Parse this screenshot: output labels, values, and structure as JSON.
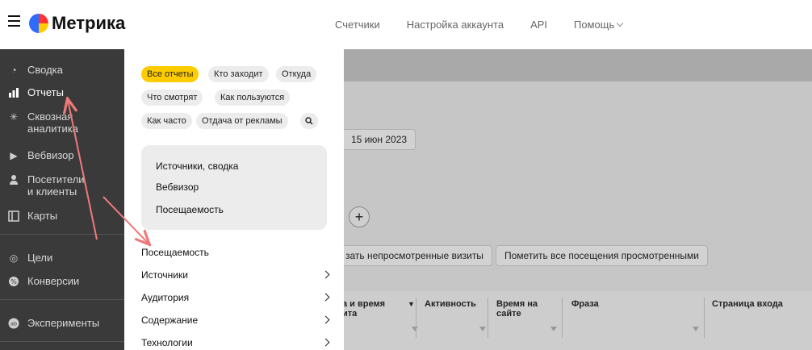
{
  "header": {
    "logo_text": "Метрика",
    "nav": [
      "Счетчики",
      "Настройка аккаунта",
      "API",
      "Помощь"
    ]
  },
  "sidebar": {
    "items": [
      {
        "label": "Сводка",
        "icon": "gauge-icon"
      },
      {
        "label": "Отчеты",
        "icon": "bar-chart-icon",
        "active": true
      },
      {
        "label": "Сквозная аналитика",
        "icon": "asterisk-icon"
      },
      {
        "label": "Вебвизор",
        "icon": "play-icon"
      },
      {
        "label": "Посетители и клиенты",
        "icon": "person-icon"
      },
      {
        "label": "Карты",
        "icon": "map-icon"
      },
      {
        "label": "Цели",
        "icon": "target-icon"
      },
      {
        "label": "Конверсии",
        "icon": "conversion-icon"
      },
      {
        "label": "Эксперименты",
        "icon": "ab-icon"
      }
    ]
  },
  "report_menu": {
    "filter_chips": [
      "Все отчеты",
      "Кто заходит",
      "Откуда",
      "Что смотрят",
      "Как пользуются",
      "Как часто",
      "Отдача от рекламы"
    ],
    "favorites": [
      "Источники, сводка",
      "Вебвизор",
      "Посещаемость"
    ],
    "items": [
      {
        "label": "Посещаемость",
        "has_submenu": false
      },
      {
        "label": "Источники",
        "has_submenu": true
      },
      {
        "label": "Аудитория",
        "has_submenu": true
      },
      {
        "label": "Содержание",
        "has_submenu": true
      },
      {
        "label": "Технологии",
        "has_submenu": true
      }
    ]
  },
  "main": {
    "date_button": "15 июн 2023",
    "show_unviewed_button": "зать непросмотренные визиты",
    "mark_viewed_button": "Пометить все посещения просмотренными",
    "table_columns": [
      "а и время\nита",
      "Активность",
      "Время на\nсайте",
      "Фраза",
      "Страница входа"
    ]
  },
  "colors": {
    "accent": "#ffcc00",
    "sidebar_bg": "#3a3a3a",
    "annotation_arrow": "#f07a7a"
  }
}
